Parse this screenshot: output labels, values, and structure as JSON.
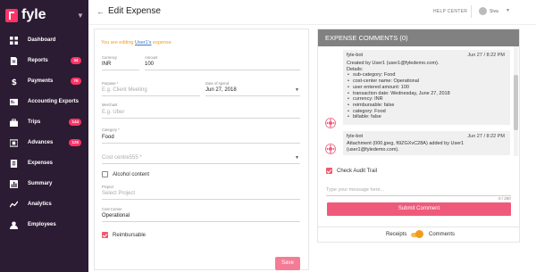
{
  "app": {
    "logo_text": "fyle"
  },
  "sidebar": {
    "items": [
      {
        "label": "Dashboard",
        "icon": "grid-icon",
        "badge": ""
      },
      {
        "label": "Reports",
        "icon": "report-icon",
        "badge": "34"
      },
      {
        "label": "Payments",
        "icon": "dollar-icon",
        "badge": "70"
      },
      {
        "label": "Accounting Exports",
        "icon": "export-icon",
        "badge": ""
      },
      {
        "label": "Trips",
        "icon": "briefcase-icon",
        "badge": "144"
      },
      {
        "label": "Advances",
        "icon": "wallet-icon",
        "badge": "120"
      },
      {
        "label": "Expenses",
        "icon": "receipt-icon",
        "badge": ""
      },
      {
        "label": "Summary",
        "icon": "bar-chart-icon",
        "badge": ""
      },
      {
        "label": "Analytics",
        "icon": "trend-icon",
        "badge": ""
      },
      {
        "label": "Employees",
        "icon": "person-icon",
        "badge": ""
      }
    ],
    "colors": {
      "background": "#2b1b33",
      "badge": "#ff3366"
    }
  },
  "header": {
    "back_icon": "arrow-left-icon",
    "title": "Edit Expense",
    "help_center": "HELP CENTER",
    "user_name": "Siva"
  },
  "form": {
    "editing_prefix": "You are editing ",
    "editing_user": "User1's",
    "editing_suffix": " expense",
    "currency_label": "Currency",
    "currency_value": "INR",
    "amount_label": "Amount",
    "amount_value": "100",
    "purpose_label": "Purpose *",
    "purpose_placeholder": "E.g. Client Meeting",
    "date_label": "Date of spend",
    "date_value": "Jun 27, 2018",
    "merchant_label": "Merchant",
    "merchant_placeholder": "E.g. Uber",
    "category_label": "Category *",
    "category_value": "Food",
    "cost_center_placeholder": "Cost centre555 *",
    "alcohol_label": "Alcohol content",
    "project_label": "Project",
    "project_placeholder": "Select Project",
    "cost_center_label": "Cost Center",
    "cost_center_value": "Operational",
    "reimbursable_label": "Reimbursable",
    "save_label": "Save"
  },
  "comments": {
    "header": "EXPENSE COMMENTS (0)",
    "list": [
      {
        "author": "fyle-bot",
        "time": "Jun 27 / 8:22 PM",
        "lines": [
          "Created by User1 (user1@fyledemo.com).",
          "Details:"
        ],
        "bullets": [
          "sub-category: Food",
          "cost-center name: Operational",
          "user entered amount: 100",
          "transaction date: Wednesday, June 27, 2018",
          "currency: INR",
          "reimbursable: false",
          "category: Food",
          "billable: false"
        ]
      },
      {
        "author": "fyle-bot",
        "time": "Jun 27 / 8:22 PM",
        "lines": [
          "Attachment (000.jpeg, fi9ZGXvC28A) added by User1",
          "(user1@fyledemo.com)."
        ],
        "bullets": []
      }
    ],
    "audit_trail_label": "Check Audit Trail",
    "message_placeholder": "Type your message here...",
    "char_count": "0 / 250",
    "submit_label": "Submit Comment",
    "toggle_left": "Receipts",
    "toggle_right": "Comments"
  }
}
